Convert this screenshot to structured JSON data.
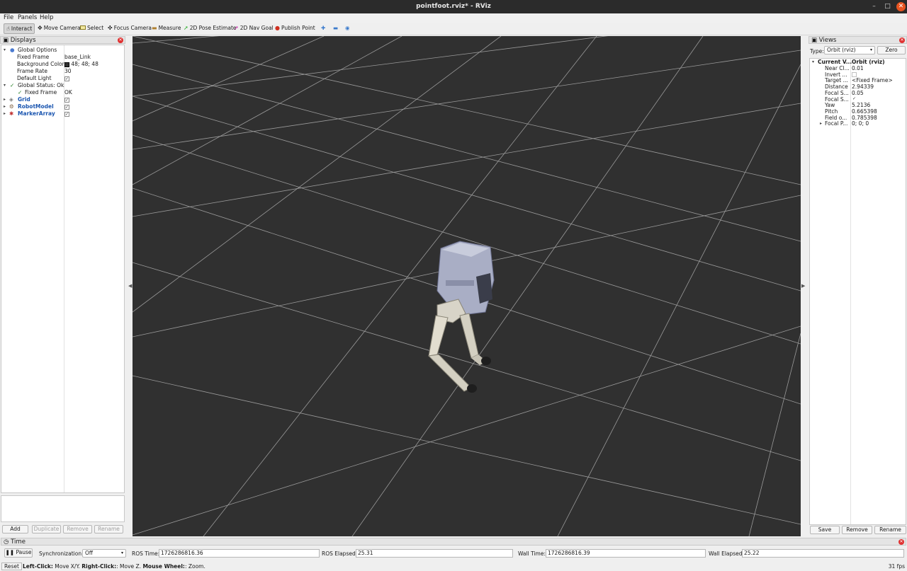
{
  "window": {
    "title": "pointfoot.rviz* - RViz"
  },
  "menu": {
    "file": "File",
    "panels": "Panels",
    "help": "Help"
  },
  "toolbar": {
    "interact": "Interact",
    "move_camera": "Move Camera",
    "select": "Select",
    "focus_camera": "Focus Camera",
    "measure": "Measure",
    "pose_estimate": "2D Pose Estimate",
    "nav_goal": "2D Nav Goal",
    "publish_point": "Publish Point"
  },
  "displays": {
    "title": "Displays",
    "global_options": "Global Options",
    "fixed_frame_label": "Fixed Frame",
    "fixed_frame_value": "base_Link",
    "bg_color_label": "Background Color",
    "bg_color_value": "48; 48; 48",
    "bg_color_swatch": "#303030",
    "frame_rate_label": "Frame Rate",
    "frame_rate_value": "30",
    "default_light_label": "Default Light",
    "global_status": "Global Status: Ok",
    "status_fixed_frame_label": "Fixed Frame",
    "status_fixed_frame_value": "OK",
    "grid": "Grid",
    "robot_model": "RobotModel",
    "marker_array": "MarkerArray",
    "buttons": {
      "add": "Add",
      "duplicate": "Duplicate",
      "remove": "Remove",
      "rename": "Rename"
    }
  },
  "views": {
    "title": "Views",
    "type_label": "Type:",
    "type_value": "Orbit (rviz)",
    "zero": "Zero",
    "current_view_label": "Current V...",
    "current_view_value": "Orbit (rviz)",
    "props": [
      {
        "k": "Near Cl...",
        "v": "0.01"
      },
      {
        "k": "Invert ...",
        "v": ""
      },
      {
        "k": "Target ...",
        "v": "<Fixed Frame>"
      },
      {
        "k": "Distance",
        "v": "2.94339"
      },
      {
        "k": "Focal S...",
        "v": "0.05"
      },
      {
        "k": "Focal S...",
        "v": ""
      },
      {
        "k": "Yaw",
        "v": "5.2136"
      },
      {
        "k": "Pitch",
        "v": "0.665398"
      },
      {
        "k": "Field o...",
        "v": "0.785398"
      },
      {
        "k": "Focal P...",
        "v": "0; 0; 0"
      }
    ],
    "buttons": {
      "save": "Save",
      "remove": "Remove",
      "rename": "Rename"
    }
  },
  "time": {
    "title": "Time",
    "pause": "Pause",
    "sync_label": "Synchronization:",
    "sync_value": "Off",
    "ros_time_label": "ROS Time:",
    "ros_time_value": "1726286816.36",
    "ros_elapsed_label": "ROS Elapsed:",
    "ros_elapsed_value": "25.31",
    "wall_time_label": "Wall Time:",
    "wall_time_value": "1726286816.39",
    "wall_elapsed_label": "Wall Elapsed:",
    "wall_elapsed_value": "25.22"
  },
  "status": {
    "reset": "Reset",
    "left_click": "Left-Click:",
    "left_click_desc": " Move X/Y. ",
    "right_click": "Right-Click:",
    "right_click_desc": ": Move Z. ",
    "wheel": "Mouse Wheel:",
    "wheel_desc": ": Zoom.",
    "fps": "31 fps"
  },
  "colors": {
    "viewport_bg": "#303030",
    "grid_line": "#a0a0a0",
    "robot_body": "#a9aec5",
    "robot_leg": "#dcd8cc",
    "accent_close": "#e95420"
  }
}
